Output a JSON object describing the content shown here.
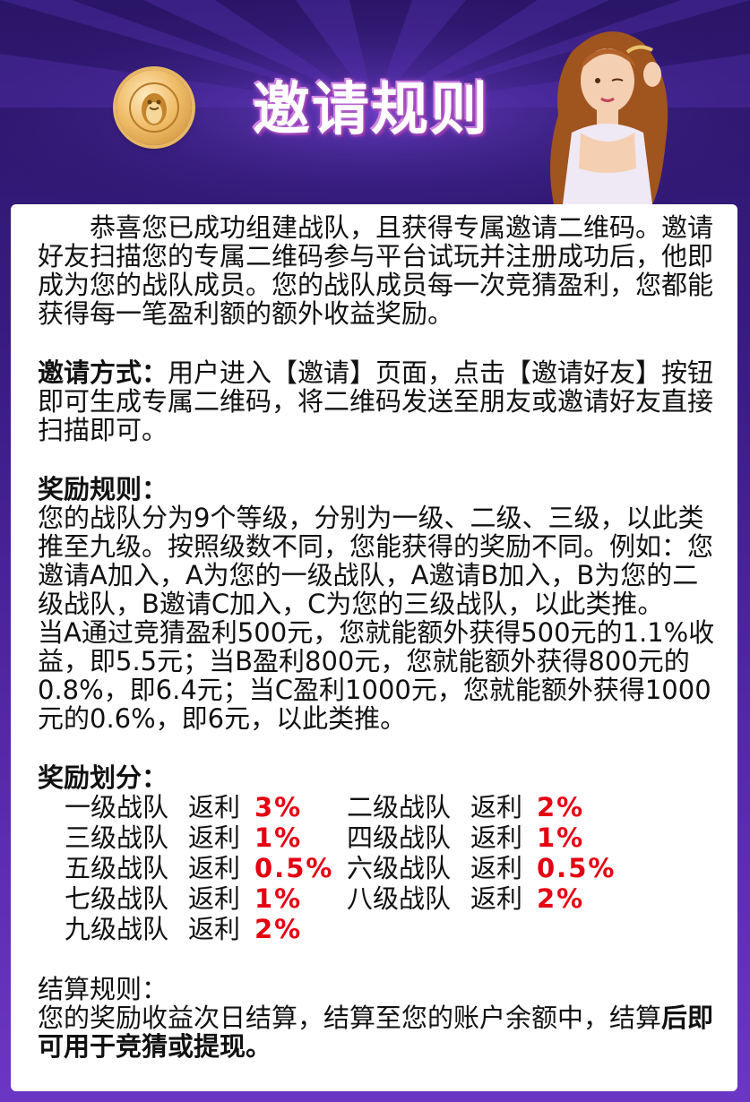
{
  "header": {
    "title": "邀请规则"
  },
  "intro": "恭喜您已成功组建战队，且获得专属邀请二维码。邀请好友扫描您的专属二维码参与平台试玩并注册成功后，他即成为您的战队成员。您的战队成员每一次竞猜盈利，您都能获得每一笔盈利额的额外收益奖励。",
  "invite": {
    "heading": "邀请方式：",
    "text": "用户进入【邀请】页面，点击【邀请好友】按钮即可生成专属二维码，将二维码发送至朋友或邀请好友直接扫描即可。"
  },
  "reward_rules": {
    "heading": "奖励规则：",
    "p1": "您的战队分为9个等级，分别为一级、二级、三级，以此类推至九级。按照级数不同，您能获得的奖励不同。例如：您邀请A加入，A为您的一级战队，A邀请B加入，B为您的二级战队，B邀请C加入，C为您的三级战队，以此类推。",
    "p2": "当A通过竞猜盈利500元，您就能额外获得500元的1.1%收益，即5.5元；当B盈利800元，您就能额外获得800元的0.8%，即6.4元；当C盈利1000元，您就能额外获得1000元的0.6%，即6元，以此类推。"
  },
  "division": {
    "heading": "奖励划分：",
    "rebate_label": "返利",
    "levels": [
      {
        "name": "一级战队",
        "pct": "3%"
      },
      {
        "name": "二级战队",
        "pct": "2%"
      },
      {
        "name": "三级战队",
        "pct": "1%"
      },
      {
        "name": "四级战队",
        "pct": "1%"
      },
      {
        "name": "五级战队",
        "pct": "0.5%"
      },
      {
        "name": "六级战队",
        "pct": "0.5%"
      },
      {
        "name": "七级战队",
        "pct": "1%"
      },
      {
        "name": "八级战队",
        "pct": "2%"
      },
      {
        "name": "九级战队",
        "pct": "2%"
      }
    ]
  },
  "settlement": {
    "heading": "结算规则：",
    "text_a": "您的奖励收益次日结算，结算至您的账户余额中，结算",
    "text_b": "后即可用于竞猜或提现。"
  },
  "colors": {
    "accent_red": "#e50012",
    "frame_purple": "#3b1c86"
  }
}
